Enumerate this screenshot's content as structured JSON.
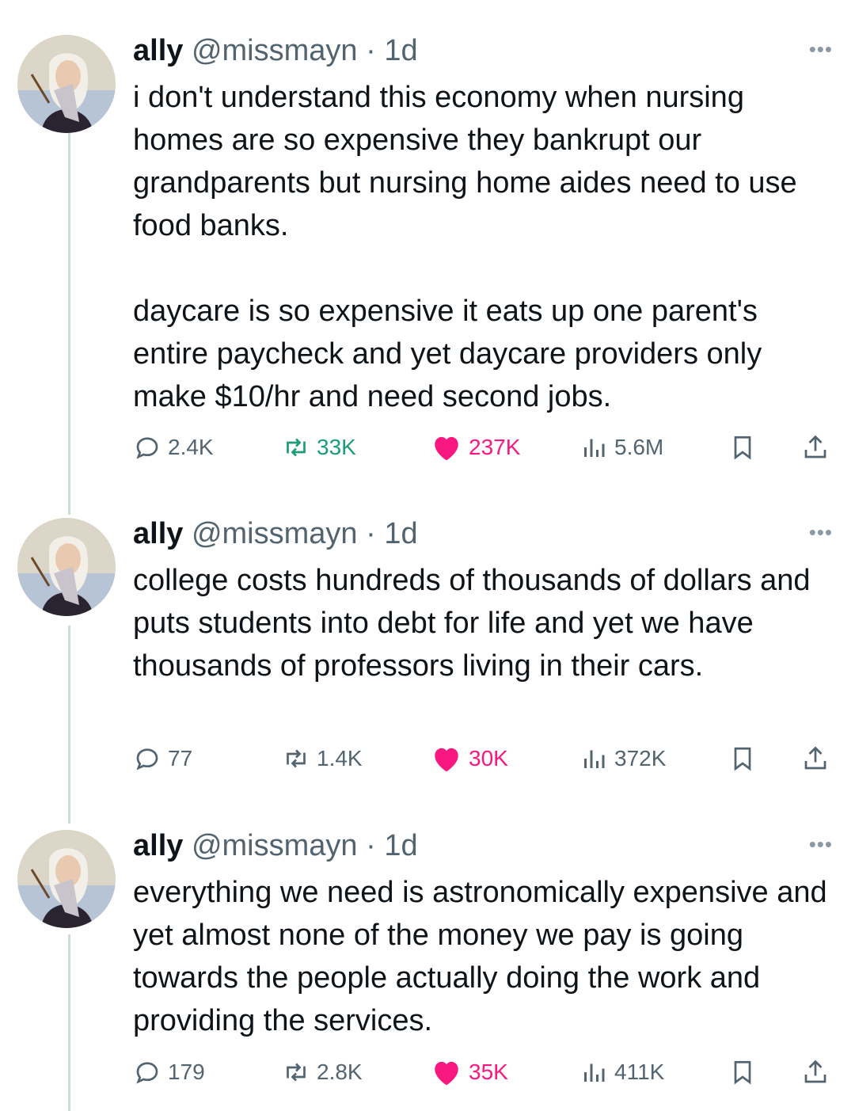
{
  "colors": {
    "text": "#0f1419",
    "secondary": "#536471",
    "like": "#f91880",
    "retweet_active": "#1d9b7a",
    "thread_line": "#cfd9de"
  },
  "icons": {
    "reply": "speech-bubble-icon",
    "retweet": "retweet-arrows-icon",
    "like": "heart-filled-icon",
    "views": "bar-chart-icon",
    "bookmark": "bookmark-icon",
    "share": "share-upload-icon",
    "more": "more-dots-icon"
  },
  "tweets": [
    {
      "name": "ally",
      "handle": "@missmayn",
      "time": "· 1d",
      "paragraphs": [
        "i don't understand this economy when nursing homes are so expensive they bankrupt our grandparents but nursing home aides need to use food banks.",
        "daycare is so expensive it eats up one parent's entire paycheck and yet daycare providers only make $10/hr and need second jobs."
      ],
      "replies": "2.4K",
      "retweets": "33K",
      "likes": "237K",
      "views": "5.6M"
    },
    {
      "name": "ally",
      "handle": "@missmayn",
      "time": "· 1d",
      "paragraphs": [
        "college costs hundreds of thousands of dollars and puts students into debt for life and yet we have thousands of professors living in their cars."
      ],
      "replies": "77",
      "retweets": "1.4K",
      "likes": "30K",
      "views": "372K"
    },
    {
      "name": "ally",
      "handle": "@missmayn",
      "time": "· 1d",
      "paragraphs": [
        "everything we need is astronomically expensive and yet almost none of the money we pay is going towards the people actually doing the work and providing the services."
      ],
      "replies": "179",
      "retweets": "2.8K",
      "likes": "35K",
      "views": "411K"
    }
  ]
}
